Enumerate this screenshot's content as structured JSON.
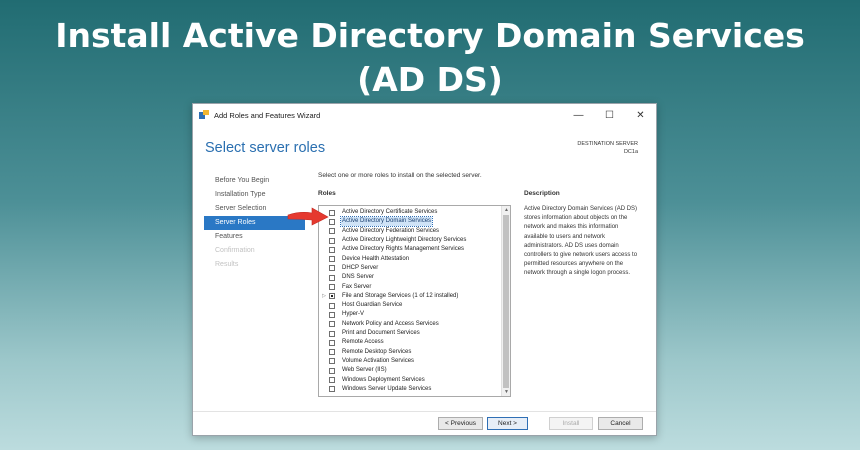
{
  "banner": {
    "line1": "Install Active Directory Domain Services",
    "line2": "(AD DS)"
  },
  "window": {
    "title": "Add Roles and Features Wizard",
    "controls": {
      "minimize": "—",
      "maximize": "☐",
      "close": "✕"
    }
  },
  "page": {
    "title": "Select server roles",
    "destination_label": "DESTINATION SERVER",
    "destination_value": "DC1a"
  },
  "nav": {
    "items": [
      {
        "label": "Before You Begin",
        "state": "normal"
      },
      {
        "label": "Installation Type",
        "state": "normal"
      },
      {
        "label": "Server Selection",
        "state": "normal"
      },
      {
        "label": "Server Roles",
        "state": "active"
      },
      {
        "label": "Features",
        "state": "normal"
      },
      {
        "label": "Confirmation",
        "state": "disabled"
      },
      {
        "label": "Results",
        "state": "disabled"
      }
    ]
  },
  "main": {
    "instruction": "Select one or more roles to install on the selected server.",
    "roles_label": "Roles",
    "description_label": "Description",
    "description_text": "Active Directory Domain Services (AD DS) stores information about objects on the network and makes this information available to users and network administrators. AD DS uses domain controllers to give network users access to permitted resources anywhere on the network through a single logon process."
  },
  "roles": [
    {
      "label": "Active Directory Certificate Services",
      "checked": false
    },
    {
      "label": "Active Directory Domain Services",
      "checked": false,
      "selected": true
    },
    {
      "label": "Active Directory Federation Services",
      "checked": false
    },
    {
      "label": "Active Directory Lightweight Directory Services",
      "checked": false
    },
    {
      "label": "Active Directory Rights Management Services",
      "checked": false
    },
    {
      "label": "Device Health Attestation",
      "checked": false
    },
    {
      "label": "DHCP Server",
      "checked": false
    },
    {
      "label": "DNS Server",
      "checked": false
    },
    {
      "label": "Fax Server",
      "checked": false
    },
    {
      "label": "File and Storage Services (1 of 12 installed)",
      "checked": "partial",
      "expandable": true
    },
    {
      "label": "Host Guardian Service",
      "checked": false
    },
    {
      "label": "Hyper-V",
      "checked": false
    },
    {
      "label": "Network Policy and Access Services",
      "checked": false
    },
    {
      "label": "Print and Document Services",
      "checked": false
    },
    {
      "label": "Remote Access",
      "checked": false
    },
    {
      "label": "Remote Desktop Services",
      "checked": false
    },
    {
      "label": "Volume Activation Services",
      "checked": false
    },
    {
      "label": "Web Server (IIS)",
      "checked": false
    },
    {
      "label": "Windows Deployment Services",
      "checked": false
    },
    {
      "label": "Windows Server Update Services",
      "checked": false
    }
  ],
  "footer": {
    "previous": "< Previous",
    "next": "Next >",
    "install": "Install",
    "cancel": "Cancel"
  },
  "colors": {
    "accent": "#2a78c5",
    "title_blue": "#2a6fb0",
    "annotation_arrow": "#e5392f"
  },
  "icons": {
    "annotation": "red-arrow-icon",
    "expand": "triangle-right-icon"
  }
}
